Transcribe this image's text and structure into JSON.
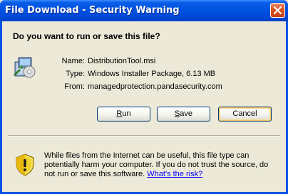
{
  "window": {
    "title": "File Download - Security Warning"
  },
  "dialog": {
    "question": "Do you want to run or save this file?",
    "file": {
      "name_label": "Name:",
      "name_value": "DistributionTool.msi",
      "type_label": "Type:",
      "type_value": "Windows Installer Package, 6.13 MB",
      "from_label": "From:",
      "from_value": "managedprotection.pandasecurity.com"
    },
    "buttons": {
      "run_prefix": "",
      "run_mnemonic": "R",
      "run_rest": "un",
      "save_prefix": "",
      "save_mnemonic": "S",
      "save_rest": "ave",
      "cancel_label": "Cancel"
    },
    "warning": {
      "text": "While files from the Internet can be useful, this file type can potentially harm your computer. If you do not trust the source, do not run or save this software.",
      "link": "What's the risk?"
    }
  },
  "icons": {
    "close": "close-icon",
    "file": "installer-package-icon",
    "warning": "security-shield-icon"
  },
  "colors": {
    "titlebar": "#0054e3",
    "close_button": "#d9531e",
    "dialog_bg": "#ece9d8",
    "link": "#0000ff"
  }
}
